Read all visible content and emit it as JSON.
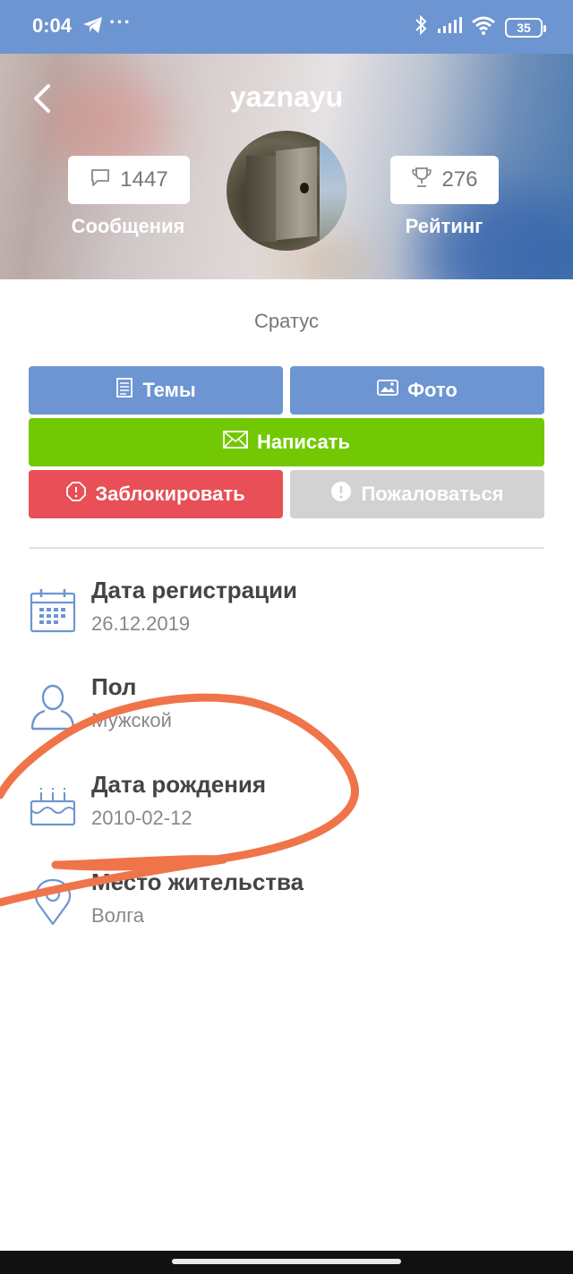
{
  "status_bar": {
    "time": "0:04",
    "dots": "···",
    "battery": "35"
  },
  "header": {
    "username": "yaznayu",
    "messages_count": "1447",
    "messages_label": "Сообщения",
    "rating_count": "276",
    "rating_label": "Рейтинг"
  },
  "profile": {
    "status": "Сратус"
  },
  "actions": {
    "topics": "Темы",
    "photo": "Фото",
    "write": "Написать",
    "block": "Заблокировать",
    "report": "Пожаловаться"
  },
  "info": [
    {
      "title": "Дата регистрации",
      "value": "26.12.2019",
      "icon": "calendar-icon"
    },
    {
      "title": "Пол",
      "value": "Мужской",
      "icon": "user-icon"
    },
    {
      "title": "Дата рождения",
      "value": "2010-02-12",
      "icon": "cake-icon"
    },
    {
      "title": "Место жительства",
      "value": "Волга",
      "icon": "location-pin-icon"
    }
  ],
  "colors": {
    "primary": "#6d95d2",
    "write": "#73c804",
    "block": "#e84f56",
    "report": "#d2d2d2",
    "annotation": "#f0744a"
  }
}
